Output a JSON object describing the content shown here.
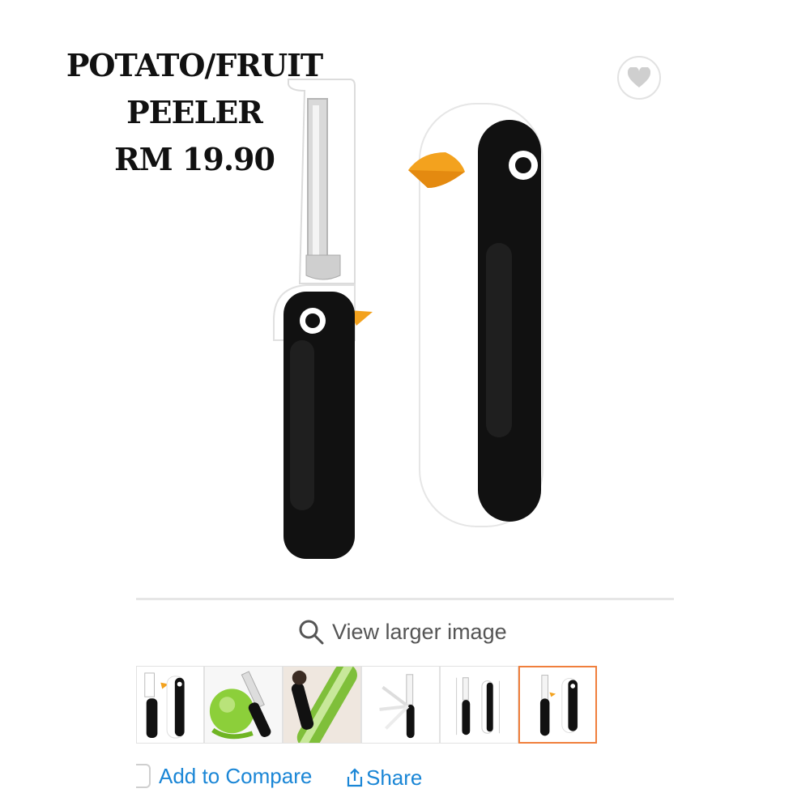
{
  "promo": {
    "line1": "POTATO/FRUIT",
    "line2": "PEELER",
    "line3": "RM 19.90"
  },
  "product": {
    "image_alt": "Penguin peeler with holder"
  },
  "actions": {
    "view_larger": "View larger image",
    "add_to_compare": "Add to Compare",
    "share": "Share"
  },
  "thumbnails": [
    {
      "name": "peeler-and-holder"
    },
    {
      "name": "peeling-apple"
    },
    {
      "name": "peeling-cucumber"
    },
    {
      "name": "rotary-opening"
    },
    {
      "name": "dimensions"
    },
    {
      "name": "peeler-and-holder-selected",
      "selected": true
    }
  ],
  "colors": {
    "accent_orange": "#f07f3c",
    "link_blue": "#1a86d6",
    "beak_orange": "#f3a21e"
  }
}
